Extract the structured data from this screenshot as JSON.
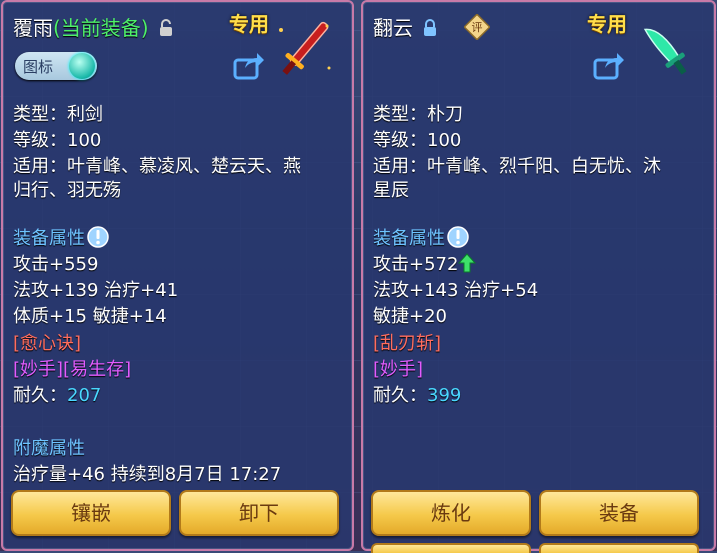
{
  "left_panel": {
    "name": "覆雨",
    "equipped_tag": "(当前装备)",
    "exclusive": "专用",
    "icon_toggle_label": "图标",
    "type_line": "类型：利剑",
    "level_line": "等级：100",
    "usable_line1": "适用：叶青峰、慕凌风、楚云天、燕",
    "usable_line2": "归行、羽无殇",
    "attr_section": "装备属性",
    "attack": "攻击+559",
    "magic_heal": "法攻+139 治疗+41",
    "phys_agi": "体质+15 敏捷+14",
    "special_skill": "[愈心诀]",
    "special_effects": "[妙手][易生存]",
    "durability_label": "耐久：",
    "durability_value": "207",
    "enchant_section": "附魔属性",
    "enchant_line": "治疗量+46 持续到8月7日 17:27",
    "btn_inlay": "镶嵌",
    "btn_unequip": "卸下"
  },
  "right_panel": {
    "name": "翻云",
    "exclusive": "专用",
    "review_badge": "评",
    "type_line": "类型：朴刀",
    "level_line": "等级：100",
    "usable_line1": "适用：叶青峰、烈千阳、白无忧、沐",
    "usable_line2": "星辰",
    "attr_section": "装备属性",
    "attack": "攻击+572",
    "magic_heal": "法攻+143 治疗+54",
    "agility": "敏捷+20",
    "special_skill": "[乱刃斩]",
    "special_effects": "[妙手]",
    "durability_label": "耐久：",
    "durability_value": "399",
    "btn_refine": "炼化",
    "btn_equip": "装备"
  },
  "colors": {
    "panel_border": "#c87aa8",
    "section": "#6ec3ff",
    "special_skill": "#ff6d5e",
    "special_effect": "#e25cff",
    "durability": "#4ad7ff",
    "equipped": "#4ef06a",
    "exclusive": "#ffde4a",
    "button": "#f5c94a"
  },
  "icons": [
    "lock-open-icon",
    "lock-closed-icon",
    "share-icon",
    "info-icon",
    "up-arrow-icon",
    "sword-icon",
    "blade-icon",
    "review-badge-icon"
  ]
}
